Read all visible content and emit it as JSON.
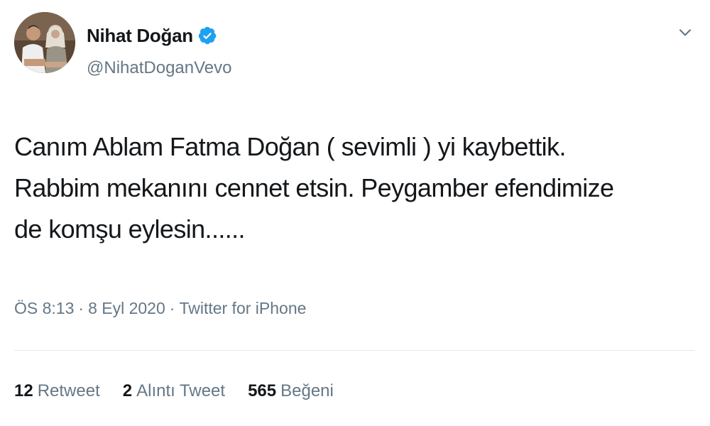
{
  "user": {
    "display_name": "Nihat Doğan",
    "handle": "@NihatDoganVevo",
    "verified": true,
    "verified_color": "#1da1f2"
  },
  "tweet": {
    "text": "Canım Ablam Fatma Doğan ( sevimli ) yi kaybettik.\nRabbim mekanını cennet etsin. Peygamber  efendimize\nde komşu eylesin......",
    "time": "ÖS 8:13",
    "separator": "·",
    "date": "8 Eyl 2020",
    "source": "Twitter for iPhone"
  },
  "stats": [
    {
      "count": "12",
      "label": "Retweet"
    },
    {
      "count": "2",
      "label": "Alıntı Tweet"
    },
    {
      "count": "565",
      "label": "Beğeni"
    }
  ],
  "icons": {
    "verified": "verified-badge-icon",
    "menu": "chevron-down-icon"
  },
  "colors": {
    "text_primary": "#14171a",
    "text_secondary": "#657786",
    "divider": "#e1e8ed"
  }
}
